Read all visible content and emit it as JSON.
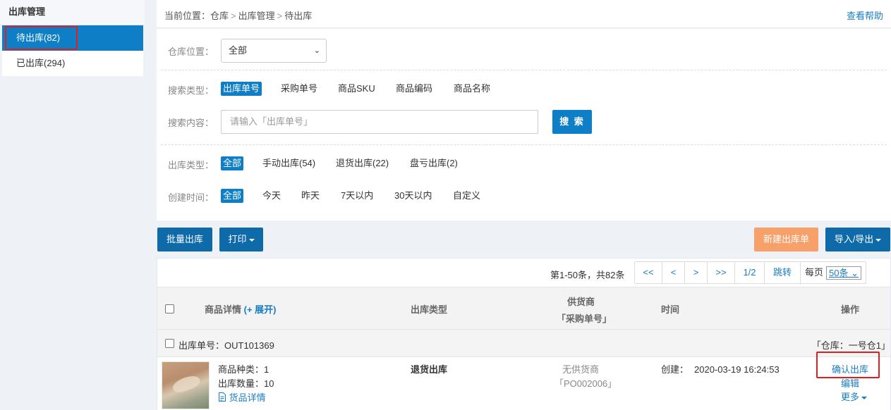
{
  "sidebar": {
    "title": "出库管理",
    "items": [
      {
        "label": "待出库(82)",
        "active": true
      },
      {
        "label": "已出库(294)",
        "active": false
      }
    ]
  },
  "breadcrumb": {
    "prefix": "当前位置：",
    "items": [
      "仓库",
      "出库管理",
      "待出库"
    ],
    "separator": ">"
  },
  "help_link": "查看帮助",
  "filters": {
    "warehouse": {
      "label": "仓库位置：",
      "value": "全部"
    },
    "search_type": {
      "label": "搜索类型：",
      "options": [
        "出库单号",
        "采购单号",
        "商品SKU",
        "商品编码",
        "商品名称"
      ],
      "selected": "出库单号"
    },
    "search_content": {
      "label": "搜索内容：",
      "placeholder": "请输入「出库单号」",
      "button": "搜 索"
    },
    "outbound_type": {
      "label": "出库类型：",
      "options": [
        "全部",
        "手动出库(54)",
        "退货出库(22)",
        "盘亏出库(2)"
      ],
      "selected": "全部"
    },
    "created_time": {
      "label": "创建时间：",
      "options": [
        "全部",
        "今天",
        "昨天",
        "7天以内",
        "30天以内",
        "自定义"
      ],
      "selected": "全部"
    }
  },
  "toolbar": {
    "batch_out": "批量出库",
    "print": "打印",
    "new_order": "新建出库单",
    "import_export": "导入/导出"
  },
  "pagination": {
    "info": "第1-50条，共82条",
    "first": "<<",
    "prev": "<",
    "next": ">",
    "last": ">>",
    "page": "1/2",
    "jump": "跳转",
    "per_page_label": "每页",
    "per_page_value": "50条"
  },
  "table": {
    "headers": {
      "product": "商品详情",
      "expand": "(+ 展开)",
      "type": "出库类型",
      "supplier_line1": "供货商",
      "supplier_line2": "「采购单号」",
      "time": "时间",
      "action": "操作"
    },
    "groups": [
      {
        "order_label": "出库单号：",
        "order_no": "OUT101369",
        "warehouse": "「仓库：一号仓1」",
        "item": {
          "kinds": "商品种类：1",
          "qty": "出库数量：10",
          "detail_link": "货品详情",
          "type": "退货出库",
          "supplier": "无供货商",
          "po": "「PO002006」",
          "created_label": "创建：",
          "created": "2020-03-19 16:24:53",
          "actions": {
            "confirm": "确认出库",
            "edit": "编辑",
            "more": "更多"
          }
        }
      }
    ]
  },
  "colors": {
    "primary": "#0e7fc6",
    "orange": "#f7a06a",
    "link": "#1a7cc2",
    "highlight": "#e02020"
  },
  "icons": [
    "document-icon",
    "caret-down-icon",
    "checkbox-icon"
  ]
}
